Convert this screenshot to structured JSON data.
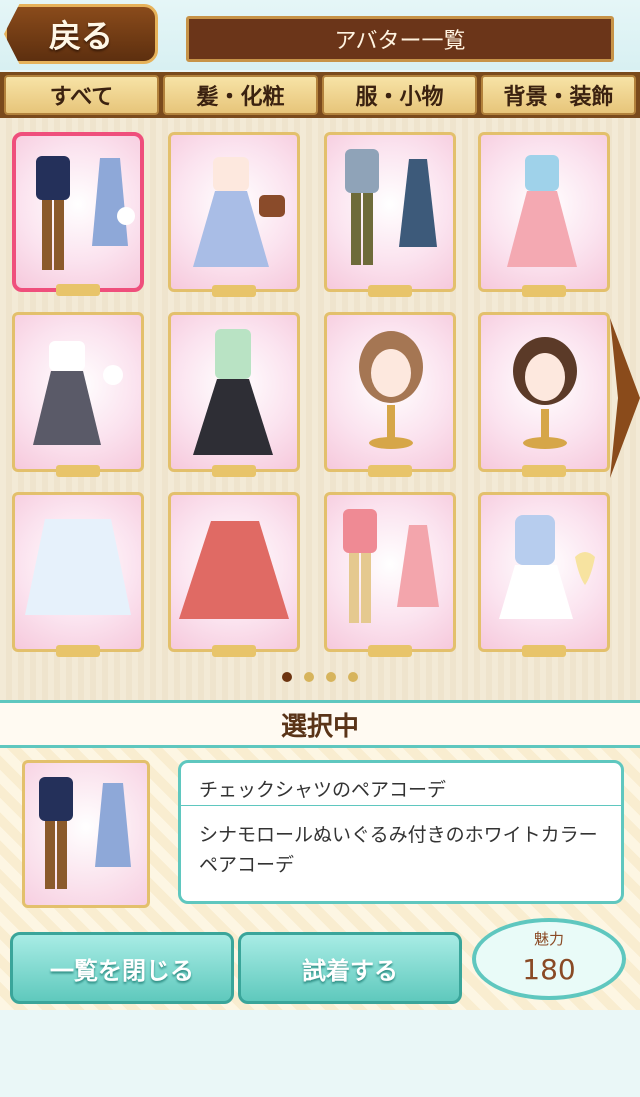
{
  "header": {
    "back_label": "戻る",
    "title": "アバター一覧"
  },
  "tabs": [
    {
      "label": "すべて"
    },
    {
      "label": "髪・化粧"
    },
    {
      "label": "服・小物"
    },
    {
      "label": "背景・装飾"
    }
  ],
  "pagination": {
    "current_page": 1,
    "total_pages": 4
  },
  "selected_section": {
    "heading": "選択中",
    "item_name": "チェックシャツのペアコーデ",
    "item_description": "シナモロールぬいぐるみ付きのホワイトカラーペアコーデ"
  },
  "actions": {
    "close_label": "一覧を閉じる",
    "try_on_label": "試着する"
  },
  "charm": {
    "label": "魅力",
    "value": "180"
  },
  "colors": {
    "accent_teal": "#5fc7bf",
    "selected_border": "#ef4f7c",
    "brown": "#6b3519"
  }
}
